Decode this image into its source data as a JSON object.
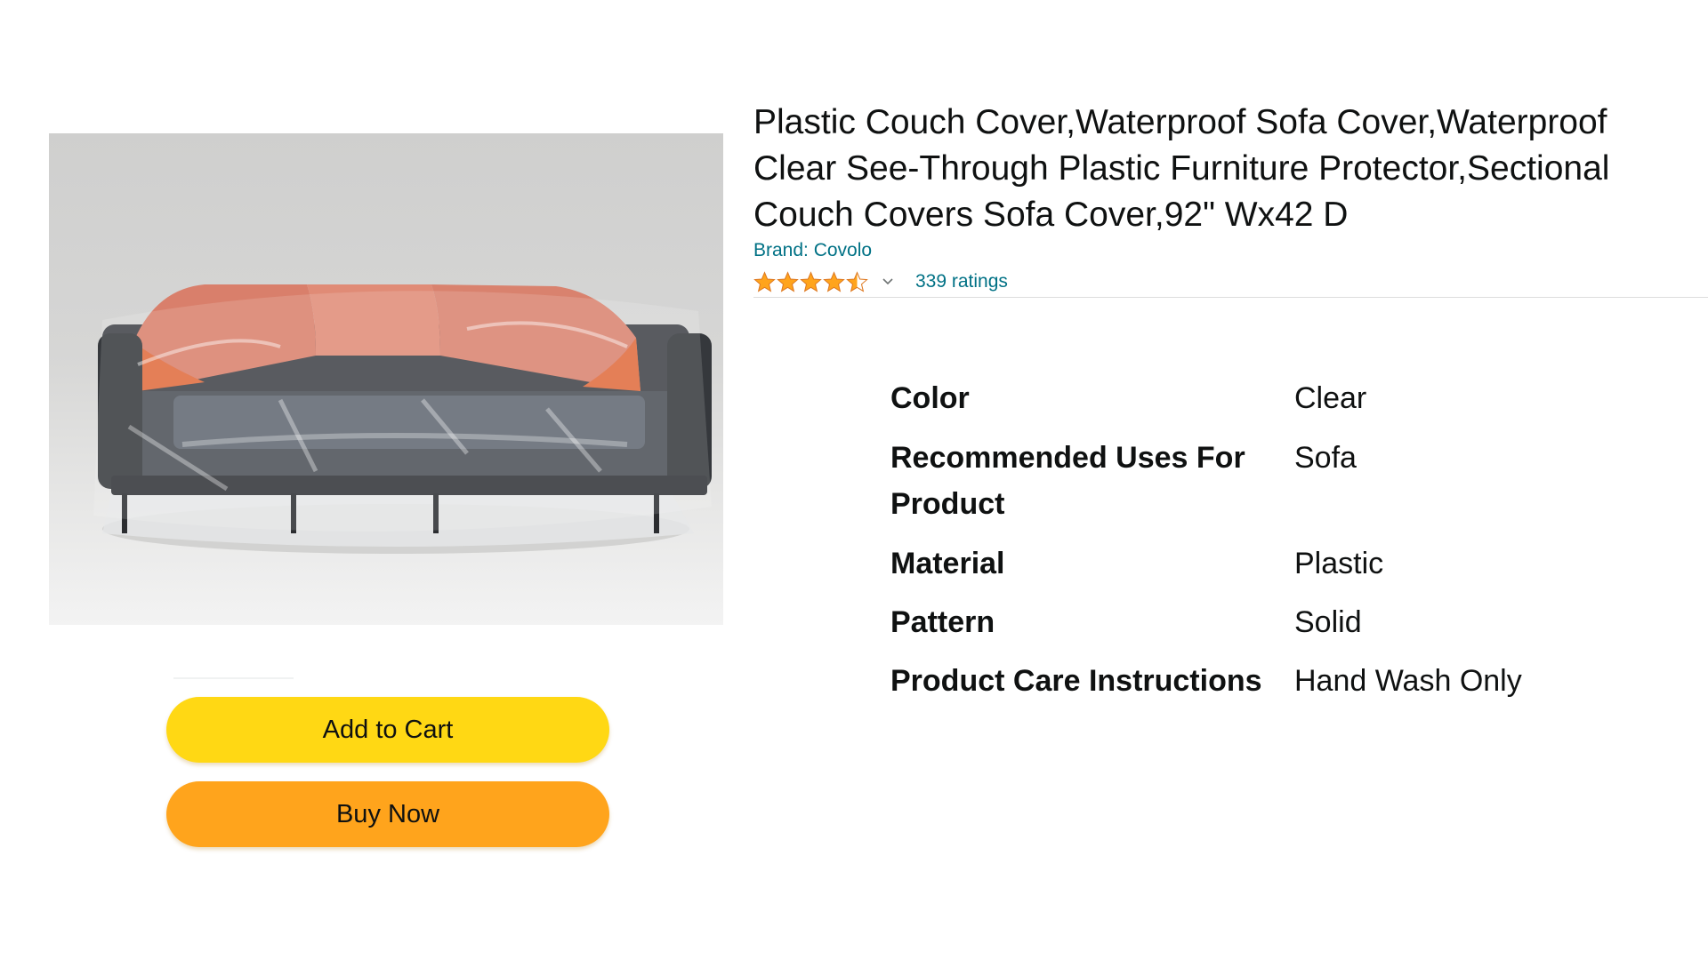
{
  "product": {
    "title": "Plastic Couch Cover,Waterproof Sofa Cover,Waterproof Clear See-Through Plastic Furniture Protector,Sectional Couch Covers Sofa Cover,92\" Wx42 D",
    "brand_label": "Brand: Covolo",
    "rating": {
      "stars": 4.5,
      "count_label": "339 ratings"
    },
    "image_alt": "clear plastic cover over gray sofa"
  },
  "actions": {
    "add_to_cart_label": "Add to Cart",
    "buy_now_label": "Buy Now"
  },
  "specs": [
    {
      "label": "Color",
      "value": "Clear"
    },
    {
      "label": "Recommended Uses For Product",
      "value": "Sofa"
    },
    {
      "label": "Material",
      "value": "Plastic"
    },
    {
      "label": "Pattern",
      "value": "Solid"
    },
    {
      "label": "Product Care Instructions",
      "value": "Hand Wash Only"
    }
  ],
  "colors": {
    "add_to_cart": "#ffd814",
    "buy_now": "#ffa41c",
    "link": "#007185",
    "star": "#ffa41c",
    "text": "#0f1111"
  },
  "icons": [
    "star-icon",
    "chevron-down-icon"
  ]
}
